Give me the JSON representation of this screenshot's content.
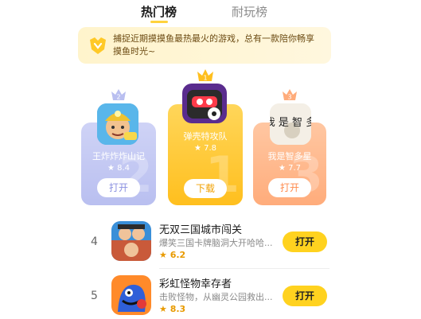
{
  "tabs": [
    {
      "label": "热门榜",
      "active": true
    },
    {
      "label": "耐玩榜",
      "active": false
    }
  ],
  "banner": {
    "text": "捕捉近期摸摸鱼最热最火的游戏，总有一款陪你畅享摸鱼时光~"
  },
  "podium": [
    {
      "rank": "2",
      "name": "王炸炸炸山记",
      "score": "8.4",
      "button": "打开",
      "icon": "miner-character-icon"
    },
    {
      "rank": "1",
      "name": "弹壳特攻队",
      "score": "7.8",
      "button": "下载",
      "icon": "helmet-robot-icon"
    },
    {
      "rank": "3",
      "name": "我是智多星",
      "score": "7.7",
      "button": "打开",
      "icon": "calligraphy-icon",
      "icon_text": "我 是 智 多"
    }
  ],
  "list": [
    {
      "rank": "4",
      "title": "无双三国城市闯关",
      "desc": "爆笑三国卡牌脑洞大开哈哈...",
      "score": "6.2",
      "button": "打开",
      "icon": "three-kingdoms-icon"
    },
    {
      "rank": "5",
      "title": "彩虹怪物幸存者",
      "desc": "击败怪物，从幽灵公园救出...",
      "score": "8.3",
      "button": "打开",
      "icon": "rainbow-monster-icon"
    }
  ],
  "colors": {
    "accent": "#ffd21f",
    "banner_bg": "#fff4cc",
    "silver": "#b9bff0",
    "gold": "#ffbf1e",
    "bronze": "#ffac7b"
  }
}
